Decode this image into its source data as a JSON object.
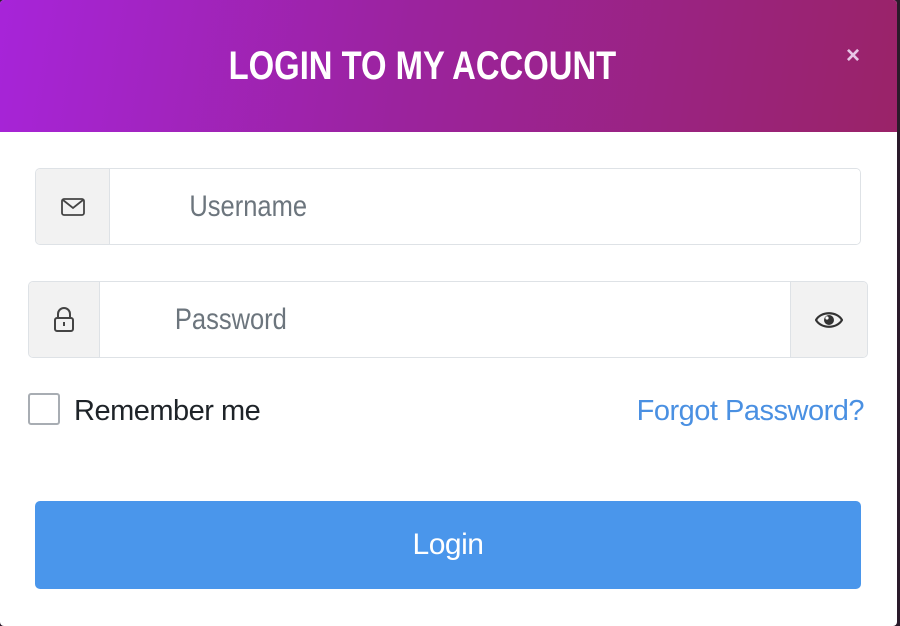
{
  "modal": {
    "title": "LOGIN TO MY ACCOUNT",
    "close_symbol": "×",
    "header_colors": [
      "#a724d9",
      "#9a2368"
    ]
  },
  "form": {
    "username": {
      "placeholder": "Username",
      "value": "",
      "icon": "envelope-icon"
    },
    "password": {
      "placeholder": "Password",
      "value": "",
      "icon": "lock-icon",
      "toggle_icon": "eye-icon"
    },
    "remember_label": "Remember me",
    "remember_checked": false,
    "forgot_label": "Forgot Password?",
    "submit_label": "Login"
  },
  "colors": {
    "accent": "#4a96eb",
    "link": "#4a90e2"
  }
}
